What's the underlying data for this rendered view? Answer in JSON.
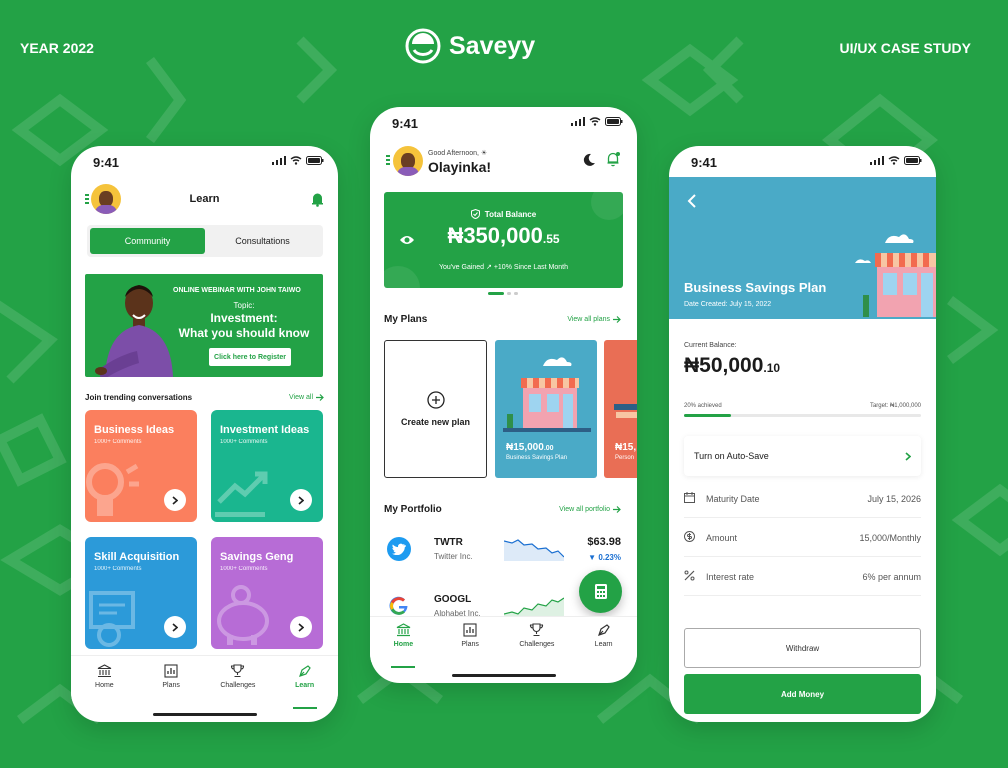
{
  "header": {
    "year_label": "YEAR 2022",
    "brand_name": "Saveyy",
    "case_study_label": "UI/UX CASE STUDY"
  },
  "colors": {
    "brand_green": "#23a246",
    "orange": "#fb7f5e",
    "teal": "#1ab68f",
    "blue": "#2c9ad9",
    "purple": "#b76cd6",
    "sky": "#4aaac7"
  },
  "status_time": "9:41",
  "learn_screen": {
    "title": "Learn",
    "tabs": [
      "Community",
      "Consultations"
    ],
    "webinar": {
      "label": "ONLINE WEBINAR WITH JOHN TAIWO",
      "topic": "Topic:",
      "title_line1": "Investment:",
      "title_line2": "What you should know",
      "cta": "Click here to Register"
    },
    "trending_title": "Join trending conversations",
    "view_all": "View all",
    "cards": [
      {
        "title": "Business Ideas",
        "comments": "1000+ Comments",
        "icon": "bulb-icon"
      },
      {
        "title": "Investment Ideas",
        "comments": "1000+ Comments",
        "icon": "trend-icon"
      },
      {
        "title": "Skill Acquisition",
        "comments": "1000+ Comments",
        "icon": "certificate-icon"
      },
      {
        "title": "Savings Geng",
        "comments": "1000+ Comments",
        "icon": "piggy-icon"
      }
    ],
    "nav": [
      "Home",
      "Plans",
      "Challenges",
      "Learn"
    ],
    "active_nav": "Learn"
  },
  "home_screen": {
    "greeting": "Good Afternoon, ☀",
    "user_name": "Olayinka!",
    "balance_label": "Total Balance",
    "balance_main": "₦350,000",
    "balance_decimal": ".55",
    "gain_text": "You've Gained ↗ +10% Since Last Month",
    "plans_title": "My Plans",
    "view_all_plans": "View all plans",
    "create_plan": "Create new plan",
    "plans": [
      {
        "amount": "₦15,000",
        "decimal": ".00",
        "name": "Business Savings Plan"
      },
      {
        "amount": "₦15,",
        "decimal": "",
        "name": "Person"
      }
    ],
    "portfolio_title": "My Portfolio",
    "view_all_portfolio": "View all portfolio",
    "portfolio": [
      {
        "ticker": "TWTR",
        "company": "Twitter Inc.",
        "price": "$63.98",
        "change": "▼ 0.23%"
      },
      {
        "ticker": "GOOGL",
        "company": "Alphabet Inc.",
        "price": "",
        "change": ""
      }
    ],
    "nav": [
      "Home",
      "Plans",
      "Challenges",
      "Learn"
    ],
    "active_nav": "Home"
  },
  "plan_screen": {
    "title": "Business Savings Plan",
    "date_created": "Date Created: July 15, 2022",
    "current_balance_label": "Current Balance:",
    "balance_main": "₦50,000",
    "balance_decimal": ".10",
    "achieved": "20% achieved",
    "achieved_fraction": 0.2,
    "target": "Target: ₦1,000,000",
    "autosave": "Turn on Auto-Save",
    "rows": [
      {
        "label": "Maturity Date",
        "value": "July 15, 2026",
        "icon": "calendar-icon"
      },
      {
        "label": "Amount",
        "value": "15,000/Monthly",
        "icon": "dollar-icon"
      },
      {
        "label": "Interest rate",
        "value": "6% per annum",
        "icon": "percent-icon"
      }
    ],
    "withdraw": "Withdraw",
    "add_money": "Add Money"
  }
}
